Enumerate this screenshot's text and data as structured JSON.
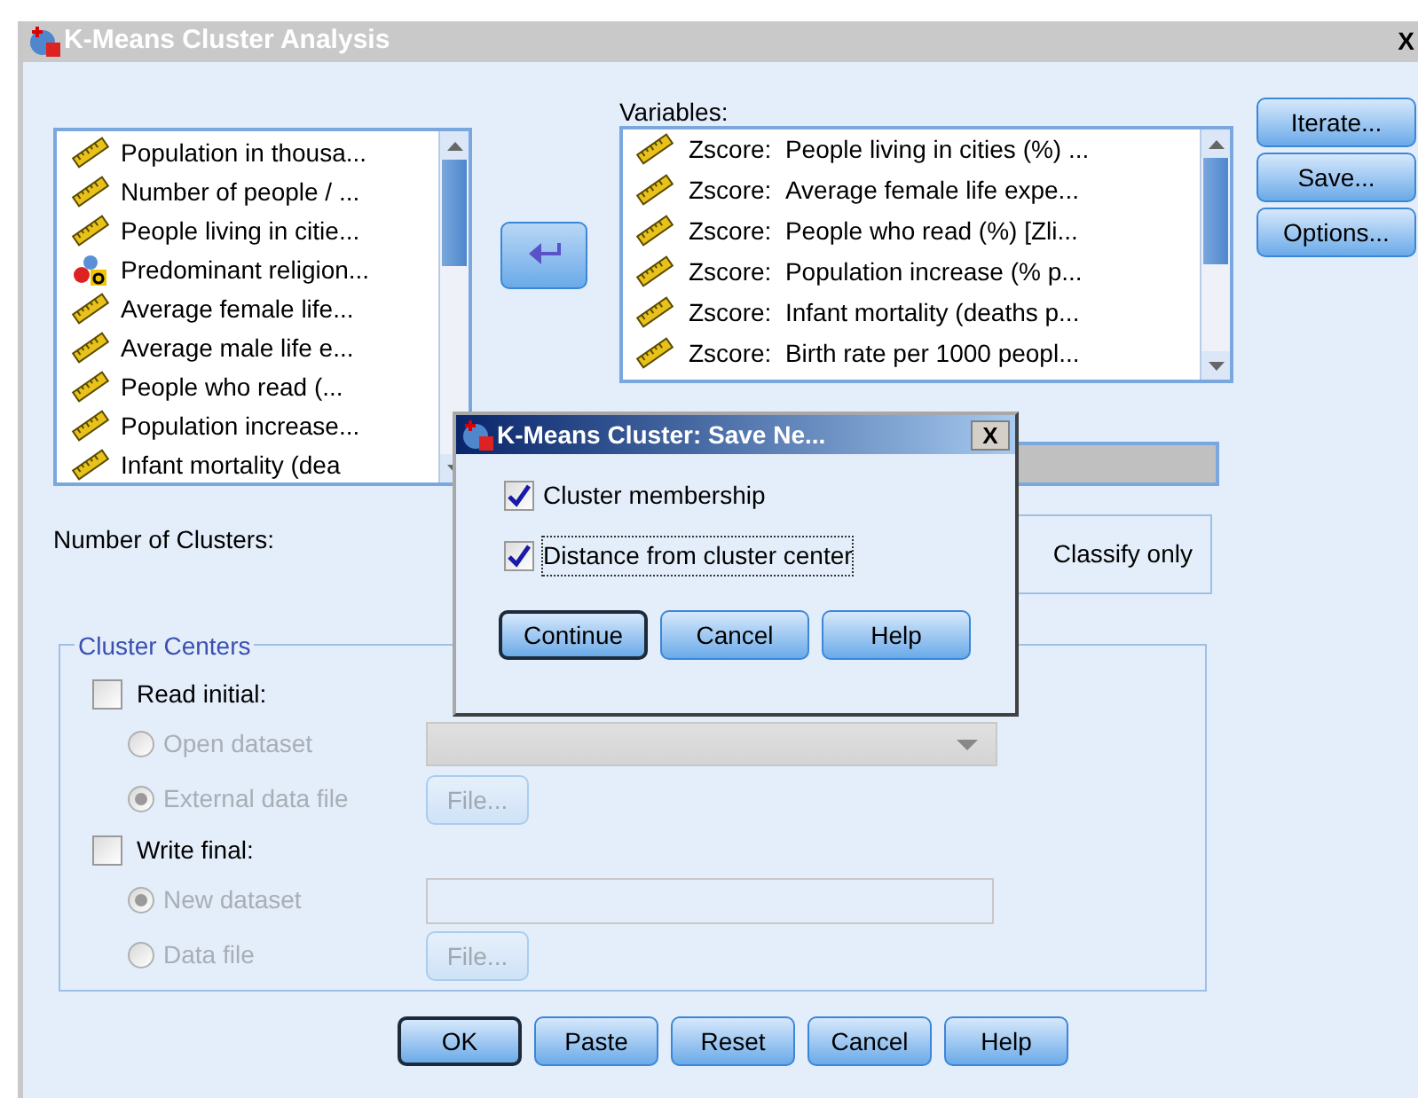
{
  "window": {
    "title": "K-Means Cluster Analysis",
    "close": "X"
  },
  "source_list": {
    "items": [
      {
        "kind": "scale",
        "label": "Population in thousa..."
      },
      {
        "kind": "scale",
        "label": "Number of people / ..."
      },
      {
        "kind": "scale",
        "label": "People living in citie..."
      },
      {
        "kind": "nominal",
        "label": "Predominant religion..."
      },
      {
        "kind": "scale",
        "label": "Average female life..."
      },
      {
        "kind": "scale",
        "label": "Average male life e..."
      },
      {
        "kind": "scale",
        "label": "People who read (..."
      },
      {
        "kind": "scale",
        "label": "Population increase..."
      },
      {
        "kind": "scale",
        "label": "Infant mortality (dea"
      }
    ]
  },
  "variables": {
    "label": "Variables:",
    "items": [
      {
        "kind": "scale",
        "prefix": "Zscore:",
        "label": "People living in cities (%) ..."
      },
      {
        "kind": "scale",
        "prefix": "Zscore:",
        "label": "Average female life expe..."
      },
      {
        "kind": "scale",
        "prefix": "Zscore:",
        "label": "People who read (%) [Zli..."
      },
      {
        "kind": "scale",
        "prefix": "Zscore:",
        "label": "Population increase (% p..."
      },
      {
        "kind": "scale",
        "prefix": "Zscore:",
        "label": "Infant mortality (deaths p..."
      },
      {
        "kind": "scale",
        "prefix": "Zscore:",
        "label": "Birth rate per 1000 peopl..."
      }
    ]
  },
  "side_buttons": [
    "Iterate...",
    "Save...",
    "Options..."
  ],
  "number_of_clusters": {
    "label": "Number of Clusters:"
  },
  "method": {
    "option": "Classify only"
  },
  "cluster_centers": {
    "title": "Cluster Centers",
    "rows": [
      {
        "kind": "checkbox",
        "label": "Read initial:",
        "checked": false
      },
      {
        "kind": "radio",
        "label": "Open dataset",
        "selected": false,
        "disabled": true,
        "control": {
          "kind": "combo"
        }
      },
      {
        "kind": "radio",
        "label": "External data file",
        "selected": true,
        "disabled": true,
        "control": {
          "kind": "file",
          "button": "File..."
        }
      },
      {
        "kind": "checkbox",
        "label": "Write final:",
        "checked": false
      },
      {
        "kind": "radio",
        "label": "New dataset",
        "selected": true,
        "disabled": true,
        "control": {
          "kind": "text"
        }
      },
      {
        "kind": "radio",
        "label": "Data file",
        "selected": false,
        "disabled": true,
        "control": {
          "kind": "file",
          "button": "File..."
        }
      }
    ]
  },
  "buttons": [
    {
      "label": "OK",
      "default": true
    },
    {
      "label": "Paste",
      "default": false
    },
    {
      "label": "Reset",
      "default": false
    },
    {
      "label": "Cancel",
      "default": false
    },
    {
      "label": "Help",
      "default": false
    }
  ],
  "save_dialog": {
    "title": "K-Means Cluster: Save Ne...",
    "close": "X",
    "options": [
      {
        "label": "Cluster membership",
        "checked": true,
        "focused": false
      },
      {
        "label": "Distance from cluster center",
        "checked": true,
        "focused": true
      }
    ],
    "buttons": [
      {
        "label": "Continue",
        "default": true
      },
      {
        "label": "Cancel",
        "default": false
      },
      {
        "label": "Help",
        "default": false
      }
    ]
  }
}
